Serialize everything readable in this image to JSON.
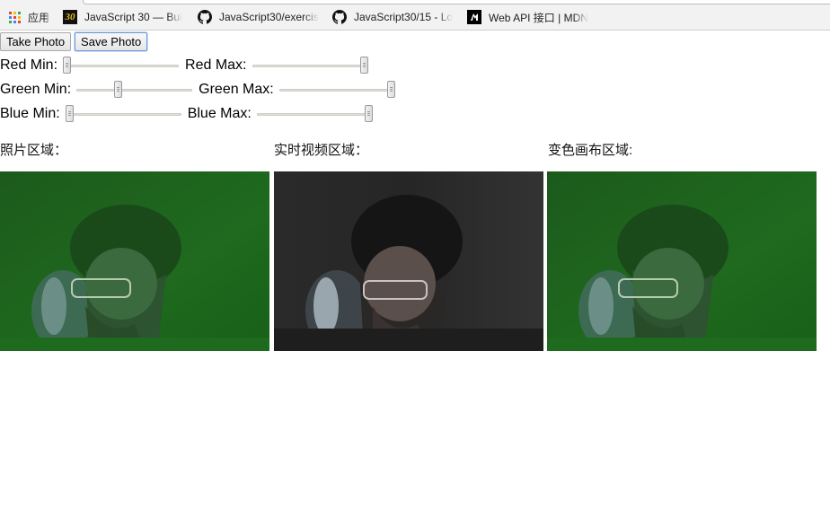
{
  "bookmarks": [
    {
      "icon": "apps-icon",
      "label": "应用"
    },
    {
      "icon": "javascript30-icon",
      "label": "JavaScript 30 — Bui"
    },
    {
      "icon": "github-icon",
      "label": "JavaScript30/exercis"
    },
    {
      "icon": "github-icon",
      "label": "JavaScript30/15 - Lo"
    },
    {
      "icon": "mdn-icon",
      "label": "Web API 接口 | MDN"
    }
  ],
  "bookmark_icon_text": {
    "js30": "30"
  },
  "toolbar": {
    "take_photo": "Take Photo",
    "save_photo": "Save Photo"
  },
  "filters": {
    "red_min_label": "Red Min:",
    "red_max_label": "Red Max:",
    "green_min_label": "Green Min:",
    "green_max_label": "Green Max:",
    "blue_min_label": "Blue Min:",
    "blue_max_label": "Blue Max:",
    "red_min": 0.0,
    "red_max": 1.0,
    "green_min": 0.35,
    "green_max": 1.0,
    "blue_min": 0.0,
    "blue_max": 1.0
  },
  "sections": {
    "photo": "照片区域：",
    "video": "实时视频区域：",
    "canvas": "变色画布区域:"
  },
  "colors": {
    "green_tint": "#1f6a1f",
    "video_gray": "#2b2b2b",
    "button_focus": "#6f9ad7"
  }
}
